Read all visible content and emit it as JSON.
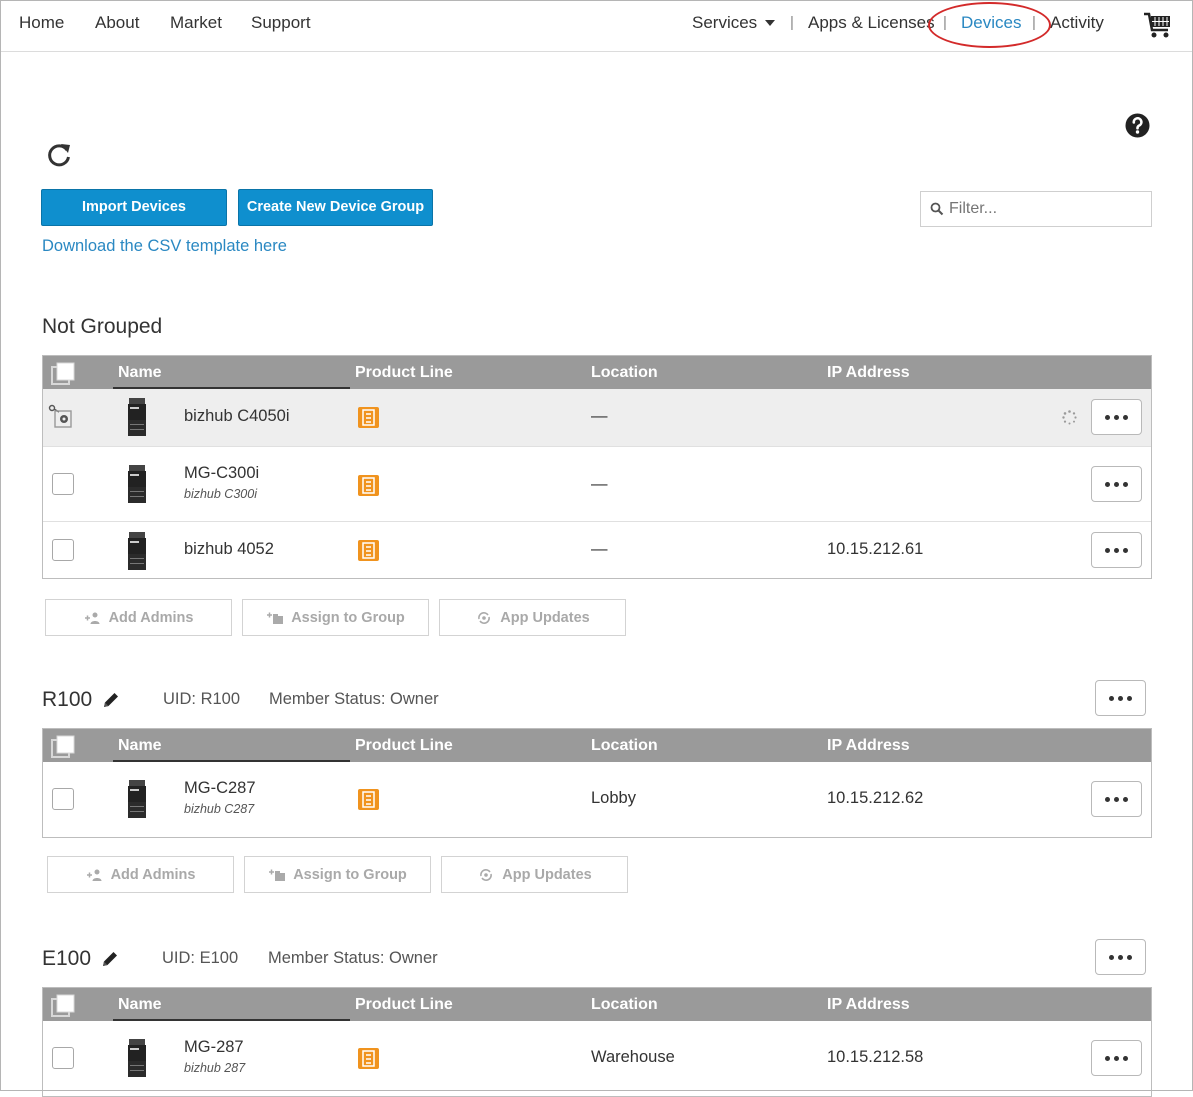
{
  "nav": {
    "left": [
      "Home",
      "About",
      "Market",
      "Support"
    ],
    "services": "Services",
    "sep": "|",
    "apps": "Apps & Licenses",
    "devices": "Devices",
    "activity": "Activity",
    "accent": "#2a88c2",
    "highlight_circle_color": "#d32a2a"
  },
  "icons": {
    "refresh": "refresh-icon",
    "help": "question-circle-icon",
    "cart": "cart-icon",
    "filter": "search-icon",
    "edit": "pencil-icon",
    "more": "ellipsis-icon",
    "product_line": "product-line-icon",
    "device": "printer-icon"
  },
  "actions": {
    "import": "Import Devices",
    "create_group": "Create New Device Group",
    "csv_link": "Download the CSV template here",
    "filter_placeholder": "Filter..."
  },
  "columns": [
    "Name",
    "Product Line",
    "Location",
    "IP Address"
  ],
  "group_actions": [
    "Add Admins",
    "Assign to Group",
    "App Updates"
  ],
  "placeholder_dash": "—",
  "groups": [
    {
      "title": "Not Grouped",
      "rows": [
        {
          "name": "bizhub C4050i",
          "model": "",
          "location": "—",
          "ip": "",
          "state": "configuring"
        },
        {
          "name": "MG-C300i",
          "model": "bizhub C300i",
          "location": "—",
          "ip": ""
        },
        {
          "name": "bizhub 4052",
          "model": "",
          "location": "—",
          "ip": "10.15.212.61"
        }
      ]
    },
    {
      "title": "R100",
      "uid": "UID: R100",
      "status": "Member Status: Owner",
      "rows": [
        {
          "name": "MG-C287",
          "model": "bizhub C287",
          "location": "Lobby",
          "ip": "10.15.212.62"
        }
      ]
    },
    {
      "title": "E100",
      "uid": "UID: E100",
      "status": "Member Status: Owner",
      "rows": [
        {
          "name": "MG-287",
          "model": "bizhub 287",
          "location": "Warehouse",
          "ip": "10.15.212.58"
        }
      ]
    }
  ]
}
